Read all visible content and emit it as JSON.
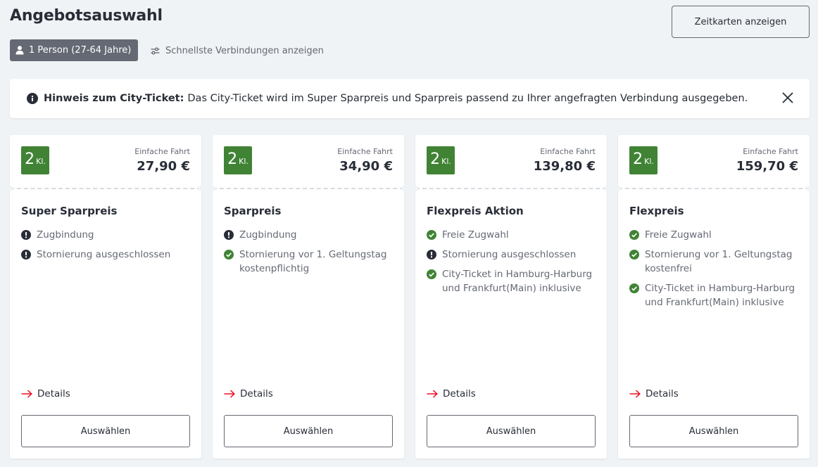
{
  "header": {
    "title": "Angebotsauswahl",
    "zeitkarten_label": "Zeitkarten anzeigen",
    "passenger_label": "1 Person (27-64 Jahre)",
    "fastest_label": "Schnellste Verbindungen anzeigen"
  },
  "notice": {
    "bold": "Hinweis zum City-Ticket:",
    "text": "Das City-Ticket wird im Super Sparpreis und Sparpreis passend zu Ihrer angefragten Verbindung ausgegeben."
  },
  "colors": {
    "accent_green": "#408335",
    "warn": "#282d37",
    "link_arrow": "#ec0016"
  },
  "offers": [
    {
      "class_num": "2",
      "class_suffix": "Kl.",
      "fare_type": "Einfache Fahrt",
      "price": "27,90 €",
      "title": "Super Sparpreis",
      "features": [
        {
          "icon": "exclamation-icon",
          "text": "Zugbindung"
        },
        {
          "icon": "exclamation-icon",
          "text": "Stornierung ausgeschlossen"
        }
      ],
      "details_label": "Details",
      "select_label": "Auswählen"
    },
    {
      "class_num": "2",
      "class_suffix": "Kl.",
      "fare_type": "Einfache Fahrt",
      "price": "34,90 €",
      "title": "Sparpreis",
      "features": [
        {
          "icon": "exclamation-icon",
          "text": "Zugbindung"
        },
        {
          "icon": "check-icon",
          "text": "Stornierung vor 1. Geltungstag kostenpflichtig"
        }
      ],
      "details_label": "Details",
      "select_label": "Auswählen"
    },
    {
      "class_num": "2",
      "class_suffix": "Kl.",
      "fare_type": "Einfache Fahrt",
      "price": "139,80 €",
      "title": "Flexpreis Aktion",
      "features": [
        {
          "icon": "check-icon",
          "text": "Freie Zugwahl"
        },
        {
          "icon": "exclamation-icon",
          "text": "Stornierung ausgeschlossen"
        },
        {
          "icon": "check-icon",
          "text": "City-Ticket in Hamburg-Harburg und Frankfurt(Main) inklusive"
        }
      ],
      "details_label": "Details",
      "select_label": "Auswählen"
    },
    {
      "class_num": "2",
      "class_suffix": "Kl.",
      "fare_type": "Einfache Fahrt",
      "price": "159,70 €",
      "title": "Flexpreis",
      "features": [
        {
          "icon": "check-icon",
          "text": "Freie Zugwahl"
        },
        {
          "icon": "check-icon",
          "text": "Stornierung vor 1. Geltungstag kostenfrei"
        },
        {
          "icon": "check-icon",
          "text": "City-Ticket in Hamburg-Harburg und Frankfurt(Main) inklusive"
        }
      ],
      "details_label": "Details",
      "select_label": "Auswählen"
    }
  ]
}
